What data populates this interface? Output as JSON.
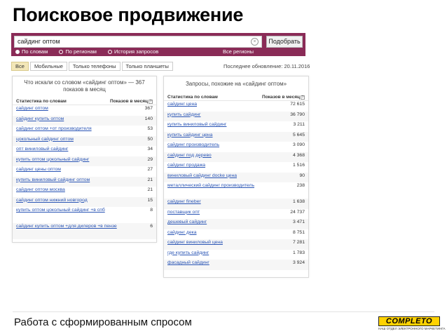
{
  "title": "Поисковое продвижение",
  "search": {
    "query": "сайдинг оптом",
    "button": "Подобрать",
    "clear_glyph": "×",
    "radios": [
      {
        "label": "По словам",
        "selected": true
      },
      {
        "label": "По регионам",
        "selected": false
      },
      {
        "label": "История запросов",
        "selected": false
      }
    ],
    "regions_link": "Все регионы"
  },
  "tabs": [
    {
      "label": "Все",
      "active": true
    },
    {
      "label": "Мобильные",
      "active": false
    },
    {
      "label": "Только телефоны",
      "active": false
    },
    {
      "label": "Только планшеты",
      "active": false
    }
  ],
  "last_updated": "Последнее обновление: 20.11.2016",
  "left_panel": {
    "title": "Что искали со словом «сайдинг оптом» — 367 показов в месяц",
    "col_query": "Статистика по словам",
    "col_count": "Показов в месяц",
    "hint_glyph": "?",
    "rows": [
      {
        "q": "сайдинг оптом",
        "v": "367"
      },
      {
        "q": "сайдинг купить оптом",
        "v": "140"
      },
      {
        "q": "сайдинг оптом +от производителя",
        "v": "53"
      },
      {
        "q": "цокольный сайдинг оптом",
        "v": "50"
      },
      {
        "q": "опт виниловый сайдинг",
        "v": "34"
      },
      {
        "q": "купить оптом цокольный сайдинг",
        "v": "29"
      },
      {
        "q": "сайдинг цены оптом",
        "v": "27"
      },
      {
        "q": "купить виниловый сайдинг оптом",
        "v": "21"
      },
      {
        "q": "сайдинг оптом москва",
        "v": "21"
      },
      {
        "q": "сайдинг оптом нижний новгород",
        "v": "15"
      },
      {
        "q": "купить оптом цокольный сайдинг +в спб",
        "v": "8"
      },
      {
        "q": "сайдинг купить оптом +для дилеров +в пензе",
        "v": "6"
      }
    ]
  },
  "right_panel": {
    "title": "Запросы, похожие на «сайдинг оптом»",
    "col_query": "Статистика по словам",
    "col_count": "Показов в месяц",
    "hint_glyph": "?",
    "rows": [
      {
        "q": "сайдинг цена",
        "v": "72 615"
      },
      {
        "q": "купить сайдинг",
        "v": "36 790"
      },
      {
        "q": "купить виниловый сайдинг",
        "v": "3 211"
      },
      {
        "q": "купить сайдинг цена",
        "v": "5 645"
      },
      {
        "q": "сайдинг производитель",
        "v": "3 090"
      },
      {
        "q": "сайдинг под дерево",
        "v": "4 368"
      },
      {
        "q": "сайдинг продажа",
        "v": "1 516"
      },
      {
        "q": "виниловый сайдинг docke цена",
        "v": "90"
      },
      {
        "q": "металлический сайдинг производитель",
        "v": "238"
      },
      {
        "q": "сайдинг fineber",
        "v": "1 638"
      },
      {
        "q": "поставщик опт",
        "v": "24 737"
      },
      {
        "q": "дешевый сайдинг",
        "v": "3 471"
      },
      {
        "q": "сайдинг дека",
        "v": "8 751"
      },
      {
        "q": "сайдинг виниловый цена",
        "v": "7 281"
      },
      {
        "q": "где купить сайдинг",
        "v": "1 783"
      },
      {
        "q": "фасадный сайдинг",
        "v": "3 924"
      }
    ]
  },
  "footer": {
    "caption": "Работа с сформированным спросом",
    "logo_text": "COMPLETO",
    "logo_tagline": "НАШ ОТДЕЛ ЭЛЕКТРОННОГО МАРКЕТИНГА"
  }
}
